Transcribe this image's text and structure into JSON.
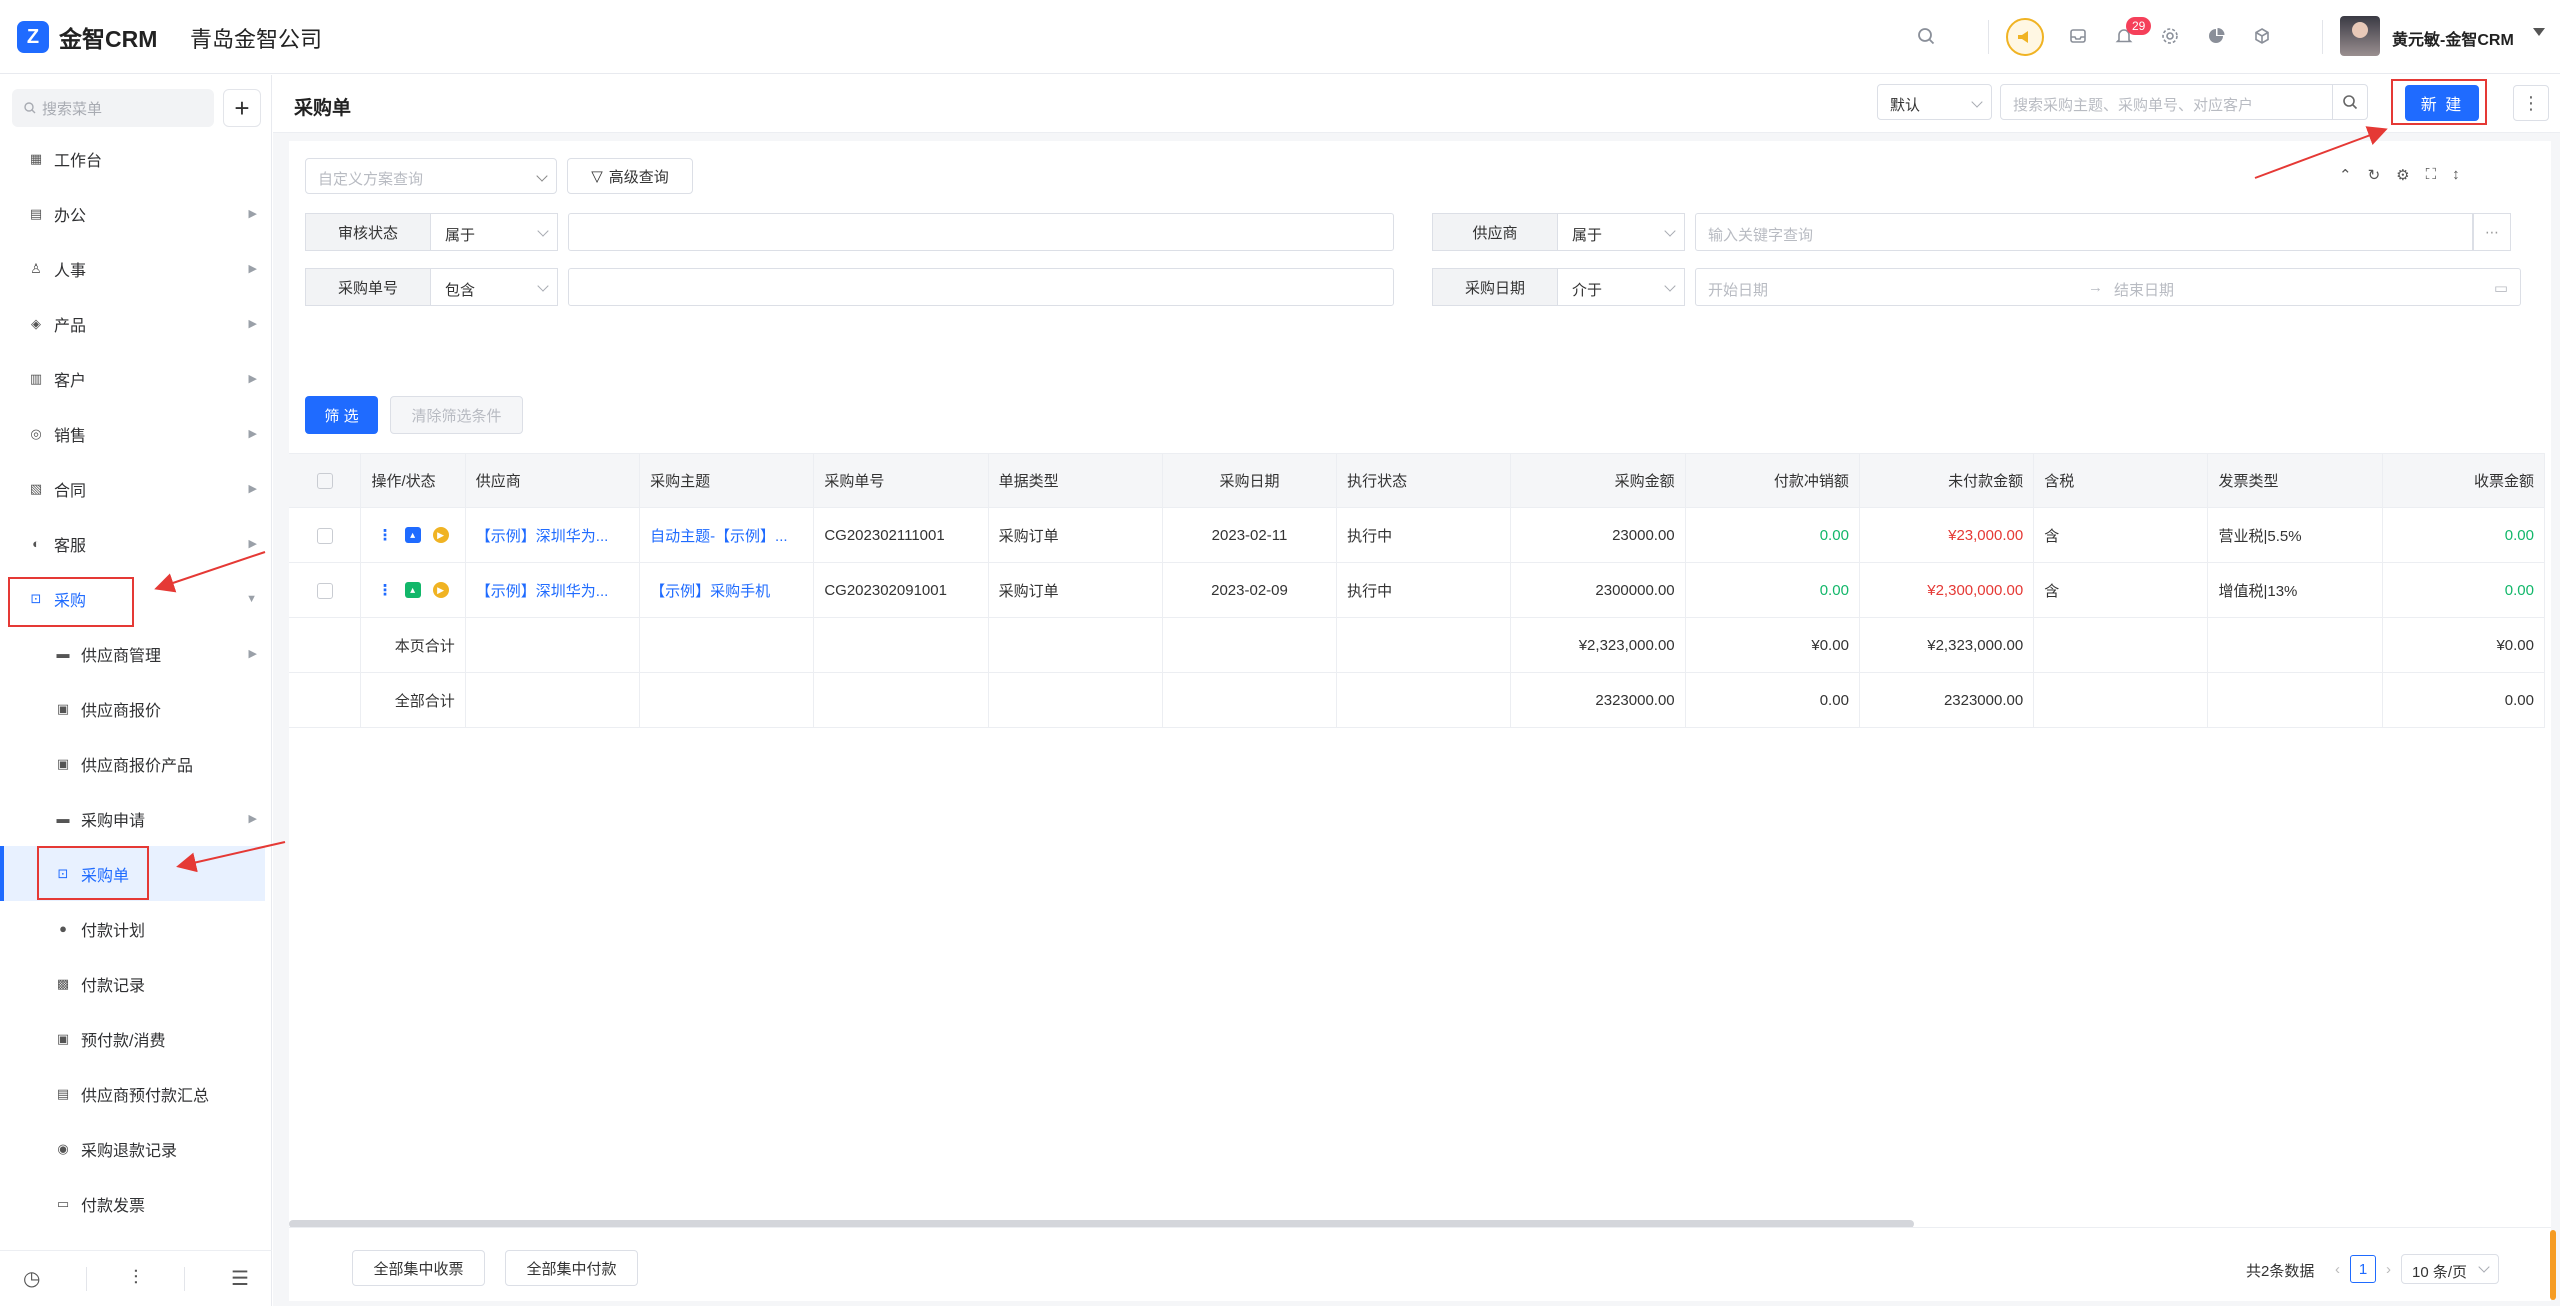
{
  "brand": {
    "logo_text": "金智CRM",
    "company": "青岛金智公司"
  },
  "topbar": {
    "notification_count": "29",
    "username": "黄元敏-金智CRM"
  },
  "sidebar": {
    "search_placeholder": "搜索菜单",
    "add_label": "+",
    "items": [
      {
        "label": "工作台",
        "icon": "dashboard-icon"
      },
      {
        "label": "办公",
        "icon": "office-icon"
      },
      {
        "label": "人事",
        "icon": "people-icon"
      },
      {
        "label": "产品",
        "icon": "cube-icon"
      },
      {
        "label": "客户",
        "icon": "customer-icon"
      },
      {
        "label": "销售",
        "icon": "sales-icon"
      },
      {
        "label": "合同",
        "icon": "contract-icon"
      },
      {
        "label": "客服",
        "icon": "headset-icon"
      },
      {
        "label": "采购",
        "icon": "purchase-icon"
      }
    ],
    "sub_items": [
      {
        "label": "供应商管理",
        "icon": "folder-icon"
      },
      {
        "label": "供应商报价",
        "icon": "quote-icon"
      },
      {
        "label": "供应商报价产品",
        "icon": "quote-product-icon"
      },
      {
        "label": "采购申请",
        "icon": "folder-icon"
      },
      {
        "label": "采购单",
        "icon": "purchase-order-icon"
      },
      {
        "label": "付款计划",
        "icon": "plan-icon"
      },
      {
        "label": "付款记录",
        "icon": "record-icon"
      },
      {
        "label": "预付款/消费",
        "icon": "prepay-icon"
      },
      {
        "label": "供应商预付款汇总",
        "icon": "summary-icon"
      },
      {
        "label": "采购退款记录",
        "icon": "refund-icon"
      },
      {
        "label": "付款发票",
        "icon": "invoice-icon"
      }
    ]
  },
  "header": {
    "title": "采购单",
    "view_select": "默认",
    "search_placeholder": "搜索采购主题、采购单号、对应客户",
    "new_button": "新 建"
  },
  "filters": {
    "custom_query_placeholder": "自定义方案查询",
    "advanced_label": "高级查询",
    "rows": [
      {
        "label": "审核状态",
        "op": "属于",
        "value": ""
      },
      {
        "label": "供应商",
        "op": "属于",
        "value": "输入关键字查询"
      },
      {
        "label": "采购单号",
        "op": "包含",
        "value": ""
      },
      {
        "label": "采购日期",
        "op": "介于",
        "start": "开始日期",
        "end": "结束日期"
      }
    ],
    "filter_button": "筛 选",
    "clear_button": "清除筛选条件"
  },
  "table": {
    "columns": [
      "操作/状态",
      "供应商",
      "采购主题",
      "采购单号",
      "单据类型",
      "采购日期",
      "执行状态",
      "采购金额",
      "付款冲销额",
      "未付款金额",
      "含税",
      "发票类型",
      "收票金额"
    ],
    "rows": [
      {
        "supplier": "【示例】深圳华为...",
        "subject": "自动主题-【示例】...",
        "order_no": "CG202302111001",
        "doc_type": "采购订单",
        "date": "2023-02-11",
        "exec_status": "执行中",
        "amount": "23000.00",
        "writeoff": "0.00",
        "unpaid": "¥23,000.00",
        "tax": "含",
        "invoice_type": "营业税|5.5%",
        "received": "0.00"
      },
      {
        "supplier": "【示例】深圳华为...",
        "subject": "【示例】采购手机",
        "order_no": "CG202302091001",
        "doc_type": "采购订单",
        "date": "2023-02-09",
        "exec_status": "执行中",
        "amount": "2300000.00",
        "writeoff": "0.00",
        "unpaid": "¥2,300,000.00",
        "tax": "含",
        "invoice_type": "增值税|13%",
        "received": "0.00"
      }
    ],
    "page_total": {
      "label": "本页合计",
      "amount": "¥2,323,000.00",
      "writeoff": "¥0.00",
      "unpaid": "¥2,323,000.00",
      "received": "¥0.00"
    },
    "all_total": {
      "label": "全部合计",
      "amount": "2323000.00",
      "writeoff": "0.00",
      "unpaid": "2323000.00",
      "received": "0.00"
    }
  },
  "footer": {
    "collect_all": "全部集中收票",
    "pay_all": "全部集中付款",
    "total_text": "共2条数据",
    "current_page": "1",
    "page_size": "10 条/页"
  },
  "colors": {
    "primary": "#1f6bff",
    "danger": "#e53935",
    "success": "#12b76a",
    "annotation": "#e53935"
  }
}
